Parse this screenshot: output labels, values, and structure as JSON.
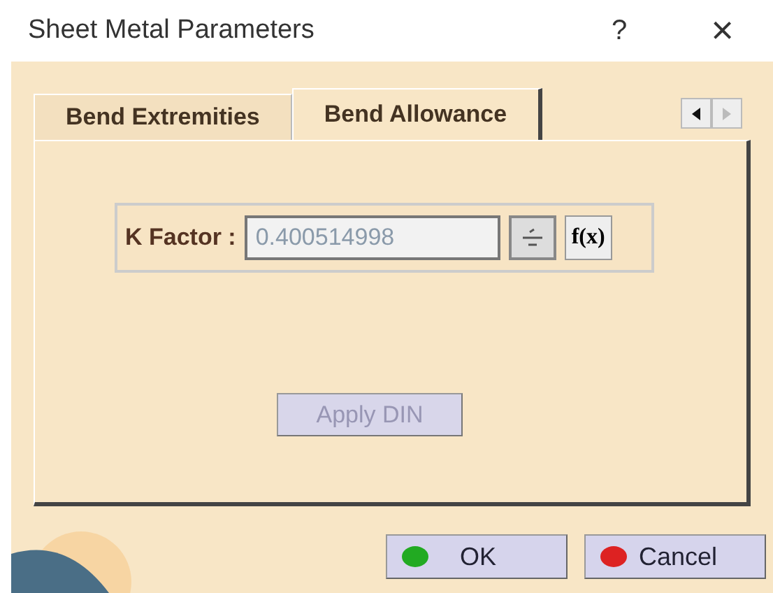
{
  "window": {
    "title": "Sheet Metal Parameters",
    "help": "?",
    "close": "×"
  },
  "tabs": [
    {
      "label": "Bend Extremities",
      "selected": false
    },
    {
      "label": "Bend Allowance",
      "selected": true
    }
  ],
  "k_factor": {
    "label": "K Factor :",
    "value": "0.400514998",
    "disabled": true,
    "formula": "f(x)"
  },
  "apply_din": {
    "label": "Apply DIN",
    "disabled": true
  },
  "buttons": [
    {
      "label": "OK",
      "kind": "ok"
    },
    {
      "label": "Cancel",
      "kind": "cancel"
    }
  ]
}
